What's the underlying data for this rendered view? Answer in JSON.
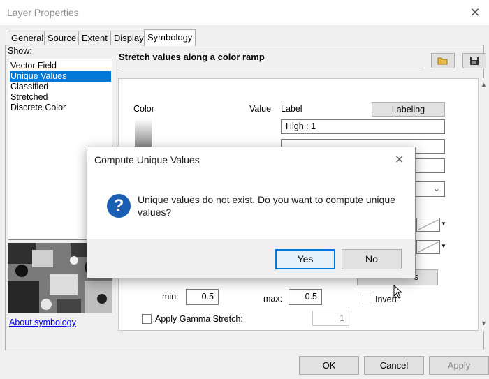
{
  "window": {
    "title": "Layer Properties"
  },
  "tabs": [
    "General",
    "Source",
    "Extent",
    "Display",
    "Symbology"
  ],
  "show": {
    "label": "Show:",
    "items": [
      "Vector Field",
      "Unique Values",
      "Classified",
      "Stretched",
      "Discrete Color"
    ],
    "selected": "Unique Values"
  },
  "about_link": "About symbology",
  "heading": "Stretch values along a color ramp",
  "toolbar": {
    "open_icon": "folder-open-icon",
    "save_icon": "save-icon"
  },
  "stretch": {
    "color_header": "Color",
    "value_header": "Value",
    "label_header": "Label",
    "labeling_button": "Labeling",
    "high_label": "High : 1",
    "histograms_button_partial": "s",
    "min_label": "min:",
    "min_value": "0.5",
    "max_label": "max:",
    "max_value": "0.5",
    "invert_label": "Invert",
    "gamma_label": "Apply Gamma Stretch:",
    "gamma_value": "1"
  },
  "dialog": {
    "title": "Compute Unique Values",
    "message": "Unique values do not exist. Do you want to compute unique values?",
    "yes": "Yes",
    "no": "No",
    "icon": "question-icon"
  },
  "footer": {
    "ok": "OK",
    "cancel": "Cancel",
    "apply": "Apply"
  },
  "colors": {
    "selection": "#0078d7",
    "dialog_icon": "#1a5fb4",
    "link": "#0000ee"
  }
}
